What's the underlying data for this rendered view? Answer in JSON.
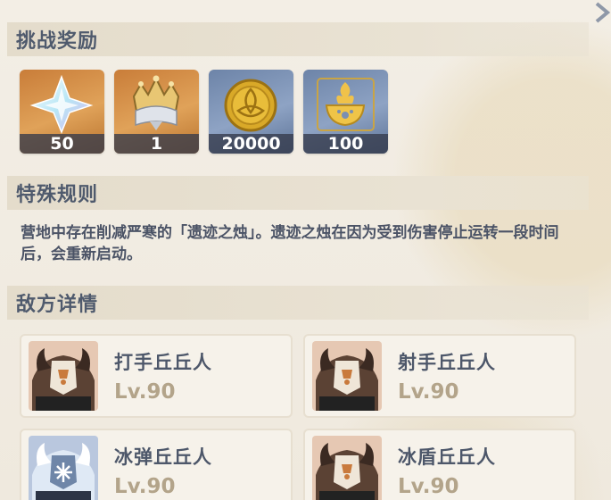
{
  "sections": {
    "rewards_title": "挑战奖励",
    "rules_title": "特殊规则",
    "enemies_title": "敌方详情"
  },
  "rewards": [
    {
      "icon": "primogem-icon",
      "quantity": "50",
      "rarity_color": "#d9954c"
    },
    {
      "icon": "crown-icon",
      "quantity": "1",
      "rarity_color": "#d9954c"
    },
    {
      "icon": "mora-coin-icon",
      "quantity": "20000",
      "rarity_color": "#7f95b8"
    },
    {
      "icon": "cooking-pot-icon",
      "quantity": "100",
      "rarity_color": "#7f95b8"
    }
  ],
  "rules": {
    "text": "营地中存在削减严寒的「遗迹之烛」。遗迹之烛在因为受到伤害停止运转一段时间后，会重新启动。"
  },
  "enemies": [
    {
      "name": "打手丘丘人",
      "level": "Lv.90",
      "icon": "hilichurl-fighter-portrait"
    },
    {
      "name": "射手丘丘人",
      "level": "Lv.90",
      "icon": "hilichurl-shooter-portrait"
    },
    {
      "name": "冰弹丘丘人",
      "level": "Lv.90",
      "icon": "cryo-slime-shooter-portrait"
    },
    {
      "name": "冰盾丘丘人",
      "level": "Lv.90",
      "icon": "ice-shield-hilichurl-portrait"
    }
  ]
}
